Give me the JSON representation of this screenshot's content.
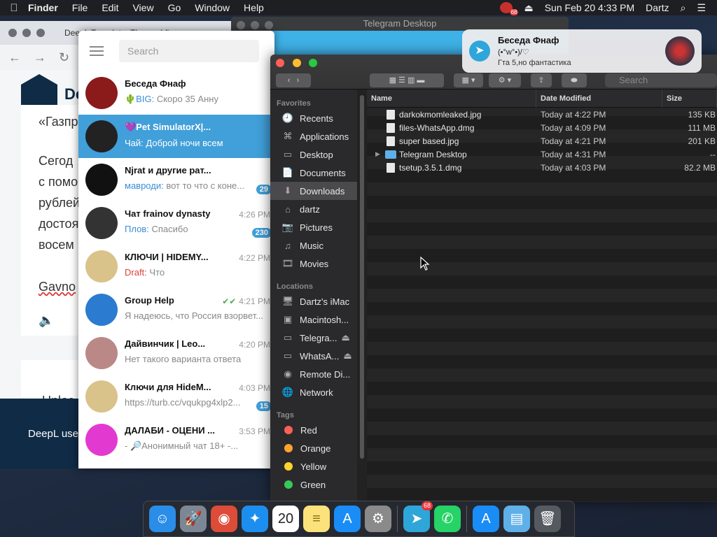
{
  "menubar": {
    "app": "Finder",
    "items": [
      "File",
      "Edit",
      "View",
      "Go",
      "Window",
      "Help"
    ],
    "telegram_badge": "68",
    "datetime": "Sun Feb 20  4:33 PM",
    "user": "Dartz"
  },
  "browser": {
    "tab_title": "DeepL Translate: The world's...",
    "brand": "De",
    "lines": [
      "«Газпр",
      "Сегод",
      "с помо",
      "рублей",
      "достоя",
      "восем"
    ],
    "input_line": "Gavno",
    "unlock": "Unloc",
    "bottom": "DeepL use"
  },
  "telegram": {
    "search_placeholder": "Search",
    "chats": [
      {
        "name": "Беседа Фнаф",
        "sender": "🌵BIG:",
        "msg": "Скоро 35 Анну",
        "time": "",
        "badge": "",
        "active": false,
        "avatar": "#8b1a1a"
      },
      {
        "name": "💜Pet SimulatorX|...",
        "sender": "Чай:",
        "msg": "Доброй ночи всем",
        "time": "",
        "badge": "",
        "active": true,
        "avatar": "#222"
      },
      {
        "name": "Njrat и другие рат...",
        "sender": "мавроди:",
        "msg": "вот то что с коне...",
        "time": "",
        "badge": "29",
        "active": false,
        "avatar": "#111"
      },
      {
        "name": "Чат frainov dynasty",
        "sender": "Плов:",
        "msg": "Спасибо",
        "time": "4:26 PM",
        "badge": "230",
        "active": false,
        "avatar": "#333"
      },
      {
        "name": "КЛЮЧИ | HIDEMY...",
        "sender": "Draft:",
        "msg": "Что",
        "time": "4:22 PM",
        "badge": "",
        "active": false,
        "avatar": "#d9c38a",
        "draft": true
      },
      {
        "name": "Group Help",
        "sender": "",
        "msg": "Я надеюсь, что Россия взорвет...",
        "time": "4:21 PM",
        "badge": "",
        "active": false,
        "avatar": "#2b7bd0",
        "checks": "✔✔"
      },
      {
        "name": "Дайвинчик | Leo...",
        "sender": "",
        "msg": "Нет такого варианта ответа",
        "time": "4:20 PM",
        "badge": "",
        "active": false,
        "avatar": "#b88"
      },
      {
        "name": "Ключи для HideM...",
        "sender": "",
        "msg": "https://turb.cc/vqukpg4xlp2...",
        "time": "4:03 PM",
        "badge": "15",
        "active": false,
        "avatar": "#d9c38a"
      },
      {
        "name": "ДАЛАБИ - ОЦЕНИ ...",
        "sender": "",
        "msg": "- 🔎Анонимный чат 18+ -...",
        "time": "3:53 PM",
        "badge": "",
        "active": false,
        "avatar": "#e23ad0"
      }
    ]
  },
  "telegram_desktop": {
    "title": "Telegram Desktop"
  },
  "notification": {
    "title": "Беседа Фнаф",
    "subtitle": "(•°w°•)/♡",
    "message": "Гта 5,но фантастика"
  },
  "finder": {
    "search_placeholder": "Search",
    "sections": [
      {
        "title": "Favorites",
        "items": [
          {
            "label": "Recents",
            "icon": "🕘"
          },
          {
            "label": "Applications",
            "icon": "⌘"
          },
          {
            "label": "Desktop",
            "icon": "▭"
          },
          {
            "label": "Documents",
            "icon": "📄"
          },
          {
            "label": "Downloads",
            "icon": "⬇",
            "selected": true
          },
          {
            "label": "dartz",
            "icon": "⌂"
          },
          {
            "label": "Pictures",
            "icon": "📷"
          },
          {
            "label": "Music",
            "icon": "♫"
          },
          {
            "label": "Movies",
            "icon": "🎞"
          }
        ]
      },
      {
        "title": "Locations",
        "items": [
          {
            "label": "Dartz's iMac",
            "icon": "🖥"
          },
          {
            "label": "Macintosh...",
            "icon": "▣"
          },
          {
            "label": "Telegra...",
            "icon": "▭",
            "eject": true
          },
          {
            "label": "WhatsA...",
            "icon": "▭",
            "eject": true
          },
          {
            "label": "Remote Di...",
            "icon": "◉"
          },
          {
            "label": "Network",
            "icon": "🌐"
          }
        ]
      },
      {
        "title": "Tags",
        "items": [
          {
            "label": "Red",
            "color": "#fe5f57"
          },
          {
            "label": "Orange",
            "color": "#fea42e"
          },
          {
            "label": "Yellow",
            "color": "#fed42e"
          },
          {
            "label": "Green",
            "color": "#36c95a"
          }
        ]
      }
    ],
    "columns": {
      "name": "Name",
      "date": "Date Modified",
      "size": "Size"
    },
    "files": [
      {
        "name": "darkokmomleaked.jpg",
        "date": "Today at 4:22 PM",
        "size": "135 KB",
        "kind": "image"
      },
      {
        "name": "files-WhatsApp.dmg",
        "date": "Today at 4:09 PM",
        "size": "111 MB",
        "kind": "file"
      },
      {
        "name": "super based.jpg",
        "date": "Today at 4:21 PM",
        "size": "201 KB",
        "kind": "image"
      },
      {
        "name": "Telegram Desktop",
        "date": "Today at 4:31 PM",
        "size": "--",
        "kind": "folder"
      },
      {
        "name": "tsetup.3.5.1.dmg",
        "date": "Today at 4:03 PM",
        "size": "82.2 MB",
        "kind": "file"
      }
    ]
  },
  "dock": {
    "items": [
      {
        "name": "finder",
        "color": "#2a8de8",
        "glyph": "☺"
      },
      {
        "name": "launchpad",
        "color": "#7b8794",
        "glyph": "🚀"
      },
      {
        "name": "chrome",
        "color": "#dd4b39",
        "glyph": "◉"
      },
      {
        "name": "safari",
        "color": "#1c8ef0",
        "glyph": "✦"
      },
      {
        "name": "calendar",
        "color": "#ffffff",
        "glyph": "20"
      },
      {
        "name": "notes",
        "color": "#fbe27a",
        "glyph": "≡"
      },
      {
        "name": "app-store",
        "color": "#1a8cf5",
        "glyph": "A"
      },
      {
        "name": "system-preferences",
        "color": "#8a8a8a",
        "glyph": "⚙"
      },
      {
        "name": "telegram",
        "color": "#2ea6da",
        "glyph": "➤",
        "badge": "68"
      },
      {
        "name": "whatsapp",
        "color": "#25d366",
        "glyph": "✆"
      },
      {
        "name": "app-store-download",
        "color": "#1a8cf5",
        "glyph": "A"
      },
      {
        "name": "downloads-stack",
        "color": "#5fb0e8",
        "glyph": "▤"
      },
      {
        "name": "trash",
        "color": "#555a60",
        "glyph": "🗑"
      }
    ]
  }
}
